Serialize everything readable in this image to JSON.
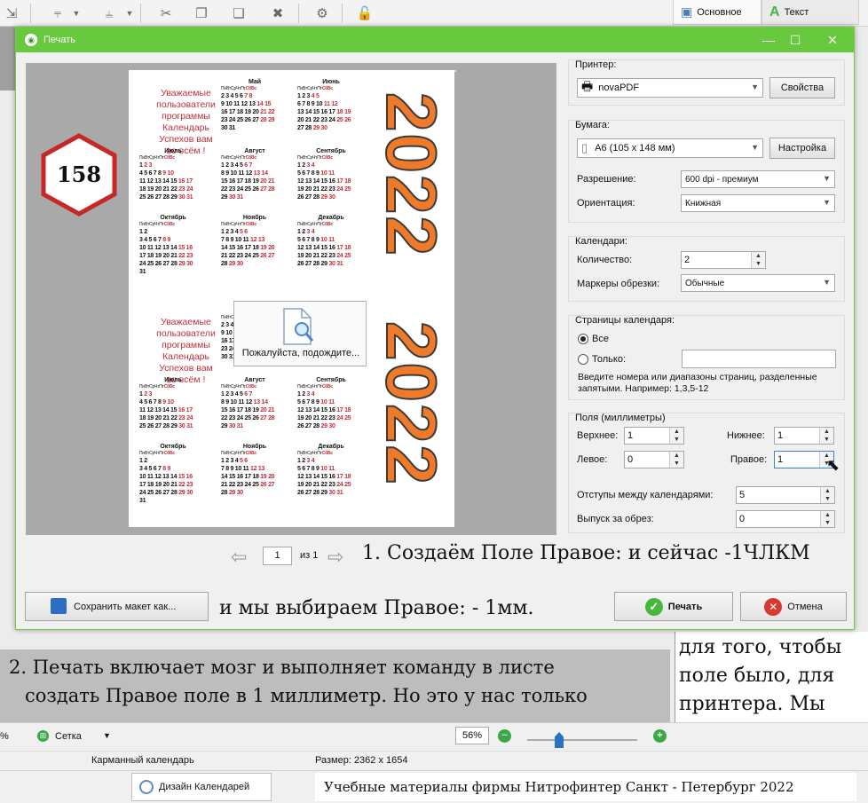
{
  "ribbon": {
    "tab_basic": "Основное",
    "tab_text": "Текст"
  },
  "dialog": {
    "title": "Печать",
    "printer": {
      "label": "Принтер:",
      "value": "novaPDF",
      "props_button": "Свойства"
    },
    "paper": {
      "label": "Бумага:",
      "value": "A6 (105 x 148 мм)",
      "setup_button": "Настройка",
      "resolution_label": "Разрешение:",
      "resolution_value": "600 dpi - премиум",
      "orientation_label": "Ориентация:",
      "orientation_value": "Книжная"
    },
    "calendars": {
      "label": "Календари:",
      "count_label": "Количество:",
      "count_value": "2",
      "marks_label": "Маркеры обрезки:",
      "marks_value": "Обычные"
    },
    "pages": {
      "label": "Страницы календаря:",
      "all": "Все",
      "only": "Только:",
      "hint": "Введите номера или диапазоны страниц, разделенные запятыми. Например: 1,3,5-12"
    },
    "margins": {
      "label": "Поля (миллиметры)",
      "top_label": "Верхнее:",
      "top_value": "1",
      "bottom_label": "Нижнее:",
      "bottom_value": "1",
      "left_label": "Левое:",
      "left_value": "0",
      "right_label": "Правое:",
      "right_value": "1",
      "gap_label": "Отступы между календарями:",
      "gap_value": "5",
      "bleed_label": "Выпуск за обрез:",
      "bleed_value": "0"
    },
    "nav": {
      "page": "1",
      "of": "из 1"
    },
    "save_button": "Сохранить макет как...",
    "print_button": "Печать",
    "cancel_button": "Отмена",
    "wait_text": "Пожалуйста, подождите..."
  },
  "calendar": {
    "greeting": [
      "Уважаемые",
      "пользователи",
      "программы",
      "Календарь",
      "Успехов вам",
      "во всём !"
    ],
    "year": "2022",
    "weekdays": [
      "Пн",
      "Вт",
      "Ср",
      "Чт",
      "Пт",
      "Сб",
      "Вс"
    ],
    "months": [
      {
        "name": "Май",
        "rows": [
          "2 3 4 5 6 7 8",
          "9 10 11 12 13 14 15",
          "16 17 18 19 20 21 22",
          "23 24 25 26 27 28 29",
          "30 31"
        ]
      },
      {
        "name": "Июнь",
        "rows": [
          "1 2 3 4 5",
          "6 7 8 9 10 11 12",
          "13 14 15 16 17 18 19",
          "20 21 22 23 24 25 26",
          "27 28 29 30"
        ]
      },
      {
        "name": "Июль",
        "rows": [
          "1 2 3",
          "4 5 6 7 8 9 10",
          "11 12 13 14 15 16 17",
          "18 19 20 21 22 23 24",
          "25 26 27 28 29 30 31"
        ]
      },
      {
        "name": "Август",
        "rows": [
          "1 2 3 4 5 6 7",
          "8 9 10 11 12 13 14",
          "15 16 17 18 19 20 21",
          "22 23 24 25 26 27 28",
          "29 30 31"
        ]
      },
      {
        "name": "Сентябрь",
        "rows": [
          "1 2 3 4",
          "5 6 7 8 9 10 11",
          "12 13 14 15 16 17 18",
          "19 20 21 22 23 24 25",
          "26 27 28 29 30"
        ]
      },
      {
        "name": "Октябрь",
        "rows": [
          "1 2",
          "3 4 5 6 7 8 9",
          "10 11 12 13 14 15 16",
          "17 18 19 20 21 22 23",
          "24 25 26 27 28 29 30",
          "31"
        ]
      },
      {
        "name": "Ноябрь",
        "rows": [
          "1 2 3 4 5 6",
          "7 8 9 10 11 12 13",
          "14 15 16 17 18 19 20",
          "21 22 23 24 25 26 27",
          "28 29 30"
        ]
      },
      {
        "name": "Декабрь",
        "rows": [
          "1 2 3 4",
          "5 6 7 8 9 10 11",
          "12 13 14 15 16 17 18",
          "19 20 21 22 23 24 25",
          "26 27 28 29 30 31"
        ]
      }
    ]
  },
  "badge": "158",
  "captions": {
    "c1": "1. Создаём Поле Правое: и сейчас -1ЧЛКМ",
    "c2": "и мы выбираем Правое: - 1мм.",
    "c3a": "2. Печать включает мозг и выполняет команду в листе",
    "c3b": "создать Правое поле в 1 миллиметр. Но это у нас только",
    "note": "для того, чтобы поле было, для принтера. Мы ещё ищем поле."
  },
  "statusbar": {
    "pct": "%",
    "grid": "Сетка",
    "zoom": "56%",
    "name": "Карманный календарь",
    "size": "Размер: 2362 x 1654",
    "tab": "Дизайн Календарей",
    "footer": "Учебные материалы фирмы Нитрофинтер Санкт - Петербург  2022"
  }
}
